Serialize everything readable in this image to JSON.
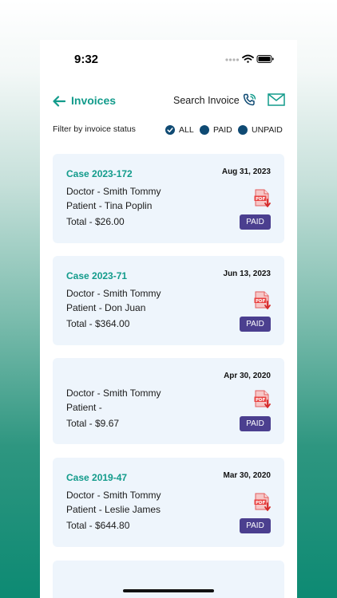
{
  "status_bar": {
    "time": "9:32"
  },
  "header": {
    "title": "Invoices",
    "search_label": "Search Invoice"
  },
  "filter": {
    "label": "Filter by invoice status",
    "options": [
      {
        "label": "ALL",
        "selected": true
      },
      {
        "label": "PAID",
        "selected": false
      },
      {
        "label": "UNPAID",
        "selected": false
      }
    ]
  },
  "invoices": [
    {
      "case": "Case 2023-172",
      "date": "Aug 31, 2023",
      "doctor": "Doctor - Smith Tommy",
      "patient": "Patient - Tina  Poplin",
      "total": "Total - $26.00",
      "status": "PAID"
    },
    {
      "case": "Case 2023-71",
      "date": "Jun 13, 2023",
      "doctor": "Doctor - Smith Tommy",
      "patient": "Patient - Don  Juan",
      "total": "Total - $364.00",
      "status": "PAID"
    },
    {
      "case": "",
      "date": "Apr 30, 2020",
      "doctor": "Doctor - Smith Tommy",
      "patient": "Patient -",
      "total": "Total - $9.67",
      "status": "PAID"
    },
    {
      "case": "Case 2019-47",
      "date": "Mar 30, 2020",
      "doctor": "Doctor - Smith Tommy",
      "patient": "Patient - Leslie  James",
      "total": "Total - $644.80",
      "status": "PAID"
    }
  ],
  "colors": {
    "accent": "#129b8b",
    "badge": "#4b3f8f",
    "card": "#eef5fc",
    "radio": "#0f4a73"
  },
  "icons": {
    "back": "arrow-left-icon",
    "call": "phone-icon",
    "mail": "mail-icon",
    "pdf": "pdf-download-icon"
  }
}
